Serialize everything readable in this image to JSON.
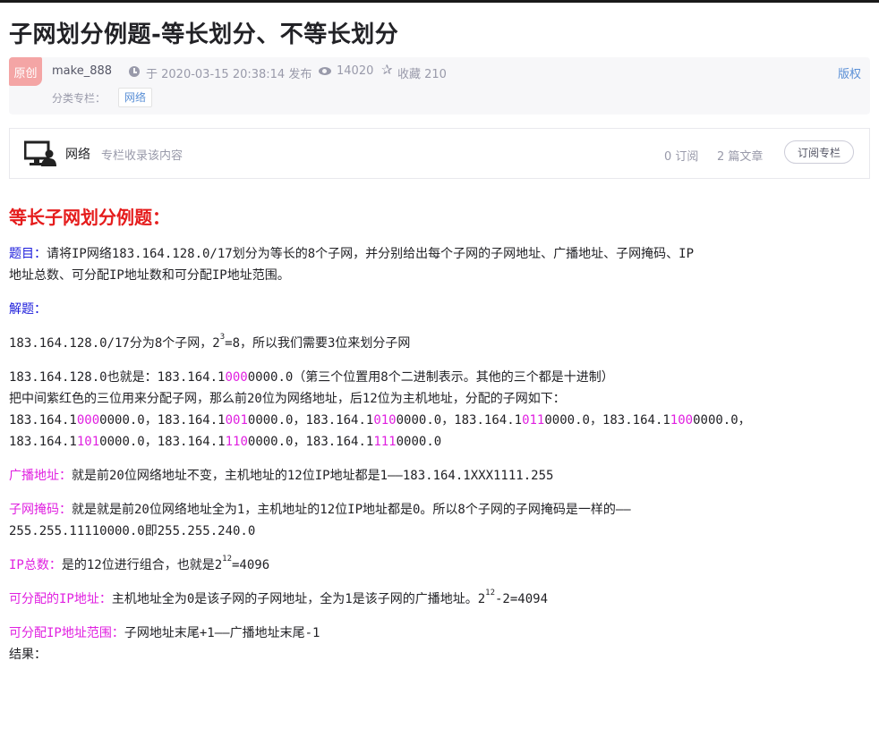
{
  "article": {
    "title": "子网划分例题-等长划分、不等长划分",
    "original_badge": "原创",
    "author": "make_888",
    "published": "于 2020-03-15 20:38:14 发布",
    "views": "14020",
    "favorites": "收藏 210",
    "copyright": "版权",
    "column_label": "分类专栏：",
    "column_tag": "网络"
  },
  "column_card": {
    "name": "网络",
    "description": "专栏收录该内容",
    "subscribers": "0 订阅",
    "articles": "2 篇文章",
    "subscribe_button": "订阅专栏"
  },
  "body": {
    "heading": "等长子网划分例题：",
    "question_label": "题目：",
    "question_line1": "请将IP网络183.164.128.0/17划分为等长的8个子网，并分别给出每个子网的子网地址、广播地址、子网掩码、IP",
    "question_line2": "地址总数、可分配IP地址数和可分配IP地址范围。",
    "answer_label": "解题：",
    "s1_a": "183.164.128.0/17分为8个子网，2",
    "s1_sup": "3",
    "s1_b": "=8，所以我们需要3位来划分子网",
    "s2_a": "183.164.128.0也就是：183.164.1",
    "s2_mag": "000",
    "s2_b": "0000.0（第三个位置用8个二进制表示。其他的三个都是十进制）",
    "s3": "把中间紫红色的三位用来分配子网，那么前20位为网络地址，后12位为主机地址，分配的子网如下：",
    "subnets_row1": [
      {
        "pre": "183.164.1",
        "bits": "000",
        "post": "0000.0",
        "sep": "，"
      },
      {
        "pre": "183.164.1",
        "bits": "001",
        "post": "0000.0",
        "sep": "，"
      },
      {
        "pre": "183.164.1",
        "bits": "010",
        "post": "0000.0",
        "sep": "，"
      },
      {
        "pre": "183.164.1",
        "bits": "011",
        "post": "0000.0",
        "sep": "，"
      },
      {
        "pre": "183.164.1",
        "bits": "100",
        "post": "0000.0",
        "sep": "，"
      }
    ],
    "subnets_row2": [
      {
        "pre": "183.164.1",
        "bits": "101",
        "post": "0000.0",
        "sep": "，"
      },
      {
        "pre": "183.164.1",
        "bits": "110",
        "post": "0000.0",
        "sep": "，"
      },
      {
        "pre": "183.164.1",
        "bits": "111",
        "post": "0000.0",
        "sep": ""
      }
    ],
    "bcast_label": "广播地址：",
    "bcast_text": "就是前20位网络地址不变，主机地址的12位IP地址都是1——183.164.1XXX1111.255",
    "mask_label": "子网掩码：",
    "mask_text1": "就是就是前20位网络地址全为1，主机地址的12位IP地址都是0。所以8个子网的子网掩码是一样的——",
    "mask_text2": "255.255.11110000.0即255.255.240.0",
    "total_label": "IP总数：",
    "total_a": "是的12位进行组合，也就是2",
    "total_sup": "12",
    "total_b": "=4096",
    "assign_label": "可分配的IP地址：",
    "assign_a": "主机地址全为0是该子网的子网地址，全为1是该子网的广播地址。2",
    "assign_sup": "12",
    "assign_b": "-2=4094",
    "range_label": "可分配IP地址范围：",
    "range_text": "子网地址末尾+1——广播地址末尾-1",
    "result": "结果："
  }
}
